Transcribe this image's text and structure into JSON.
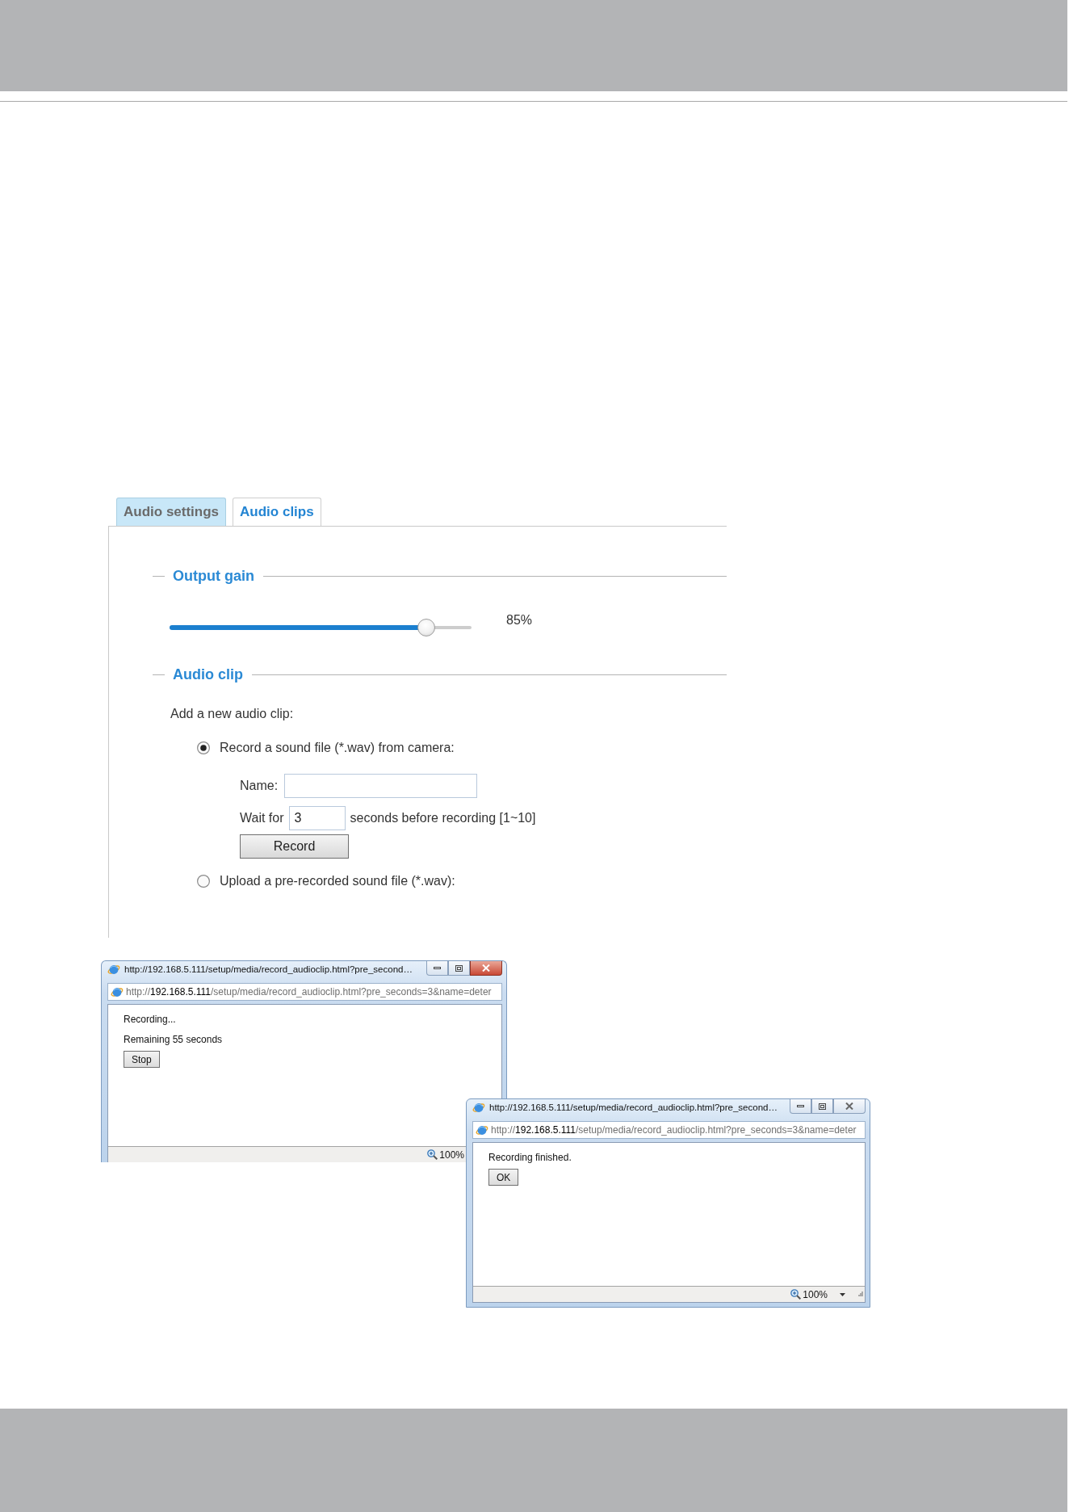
{
  "tabs": [
    {
      "label": "Audio settings",
      "selected": false
    },
    {
      "label": "Audio clips",
      "selected": true
    }
  ],
  "sections": [
    {
      "kind": "slider",
      "title": "Output gain",
      "level": 0.85,
      "reading": "85%"
    },
    {
      "kind": "clip",
      "title": "Audio clip",
      "intro": "Add a new audio clip:",
      "options": [
        {
          "label": "Record a sound file (*.wav) from camera:",
          "selected": true,
          "fields": [
            {
              "label": "Name:"
            },
            {
              "label": "Wait for",
              "value": "3",
              "suffix": "seconds before recording [1~10]"
            }
          ],
          "button": "Record"
        },
        {
          "label": "Upload a pre-recorded sound file (*.wav):",
          "selected": false
        }
      ]
    }
  ],
  "popups": [
    {
      "title": "http://192.168.5.111/setup/media/record_audioclip.html?pre_second…",
      "active": true,
      "address": "http://**192.168.5.111**/setup/media/record_audioclip.html?pre_seconds=3&name=deter",
      "lines": [
        "Recording...",
        "Remaining 55 seconds"
      ],
      "button": "Stop",
      "zoom": "100%",
      "zoom_menu": false
    },
    {
      "title": "http://192.168.5.111/setup/media/record_audioclip.html?pre_second…",
      "active": false,
      "address": "http://**192.168.5.111**/setup/media/record_audioclip.html?pre_seconds=3&name=deter",
      "lines": [
        "Recording finished."
      ],
      "button": "OK",
      "zoom": "100%",
      "zoom_menu": true
    }
  ]
}
